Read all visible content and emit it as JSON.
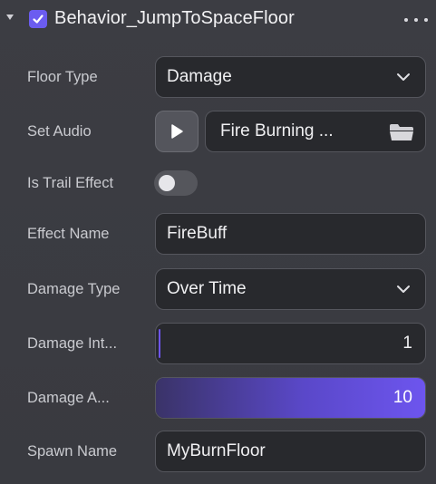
{
  "component": {
    "title": "Behavior_JumpToSpaceFloor",
    "enabled": true,
    "expanded": true
  },
  "colors": {
    "accent": "#6b5cf0",
    "panel_bg": "#3a3b41",
    "field_bg": "#28292d"
  },
  "icons": {
    "collapse": "triangle-down-icon",
    "checkbox": "checkmark-icon",
    "more": "more-horizontal-icon",
    "dropdown": "chevron-down-icon",
    "play": "play-icon",
    "folder": "folder-icon"
  },
  "properties": {
    "floor_type": {
      "label": "Floor Type",
      "value": "Damage"
    },
    "set_audio": {
      "label": "Set Audio",
      "value": "Fire Burning ..."
    },
    "is_trail_effect": {
      "label": "Is Trail Effect",
      "on": false
    },
    "effect_name": {
      "label": "Effect Name",
      "value": "FireBuff"
    },
    "damage_type": {
      "label": "Damage Type",
      "value": "Over Time"
    },
    "damage_interval": {
      "label": "Damage Int...",
      "value": "1",
      "fill_fraction": 0.0
    },
    "damage_amount": {
      "label": "Damage A...",
      "value": "10",
      "fill_fraction": 1.0
    },
    "spawn_name": {
      "label": "Spawn Name",
      "value": "MyBurnFloor"
    }
  }
}
